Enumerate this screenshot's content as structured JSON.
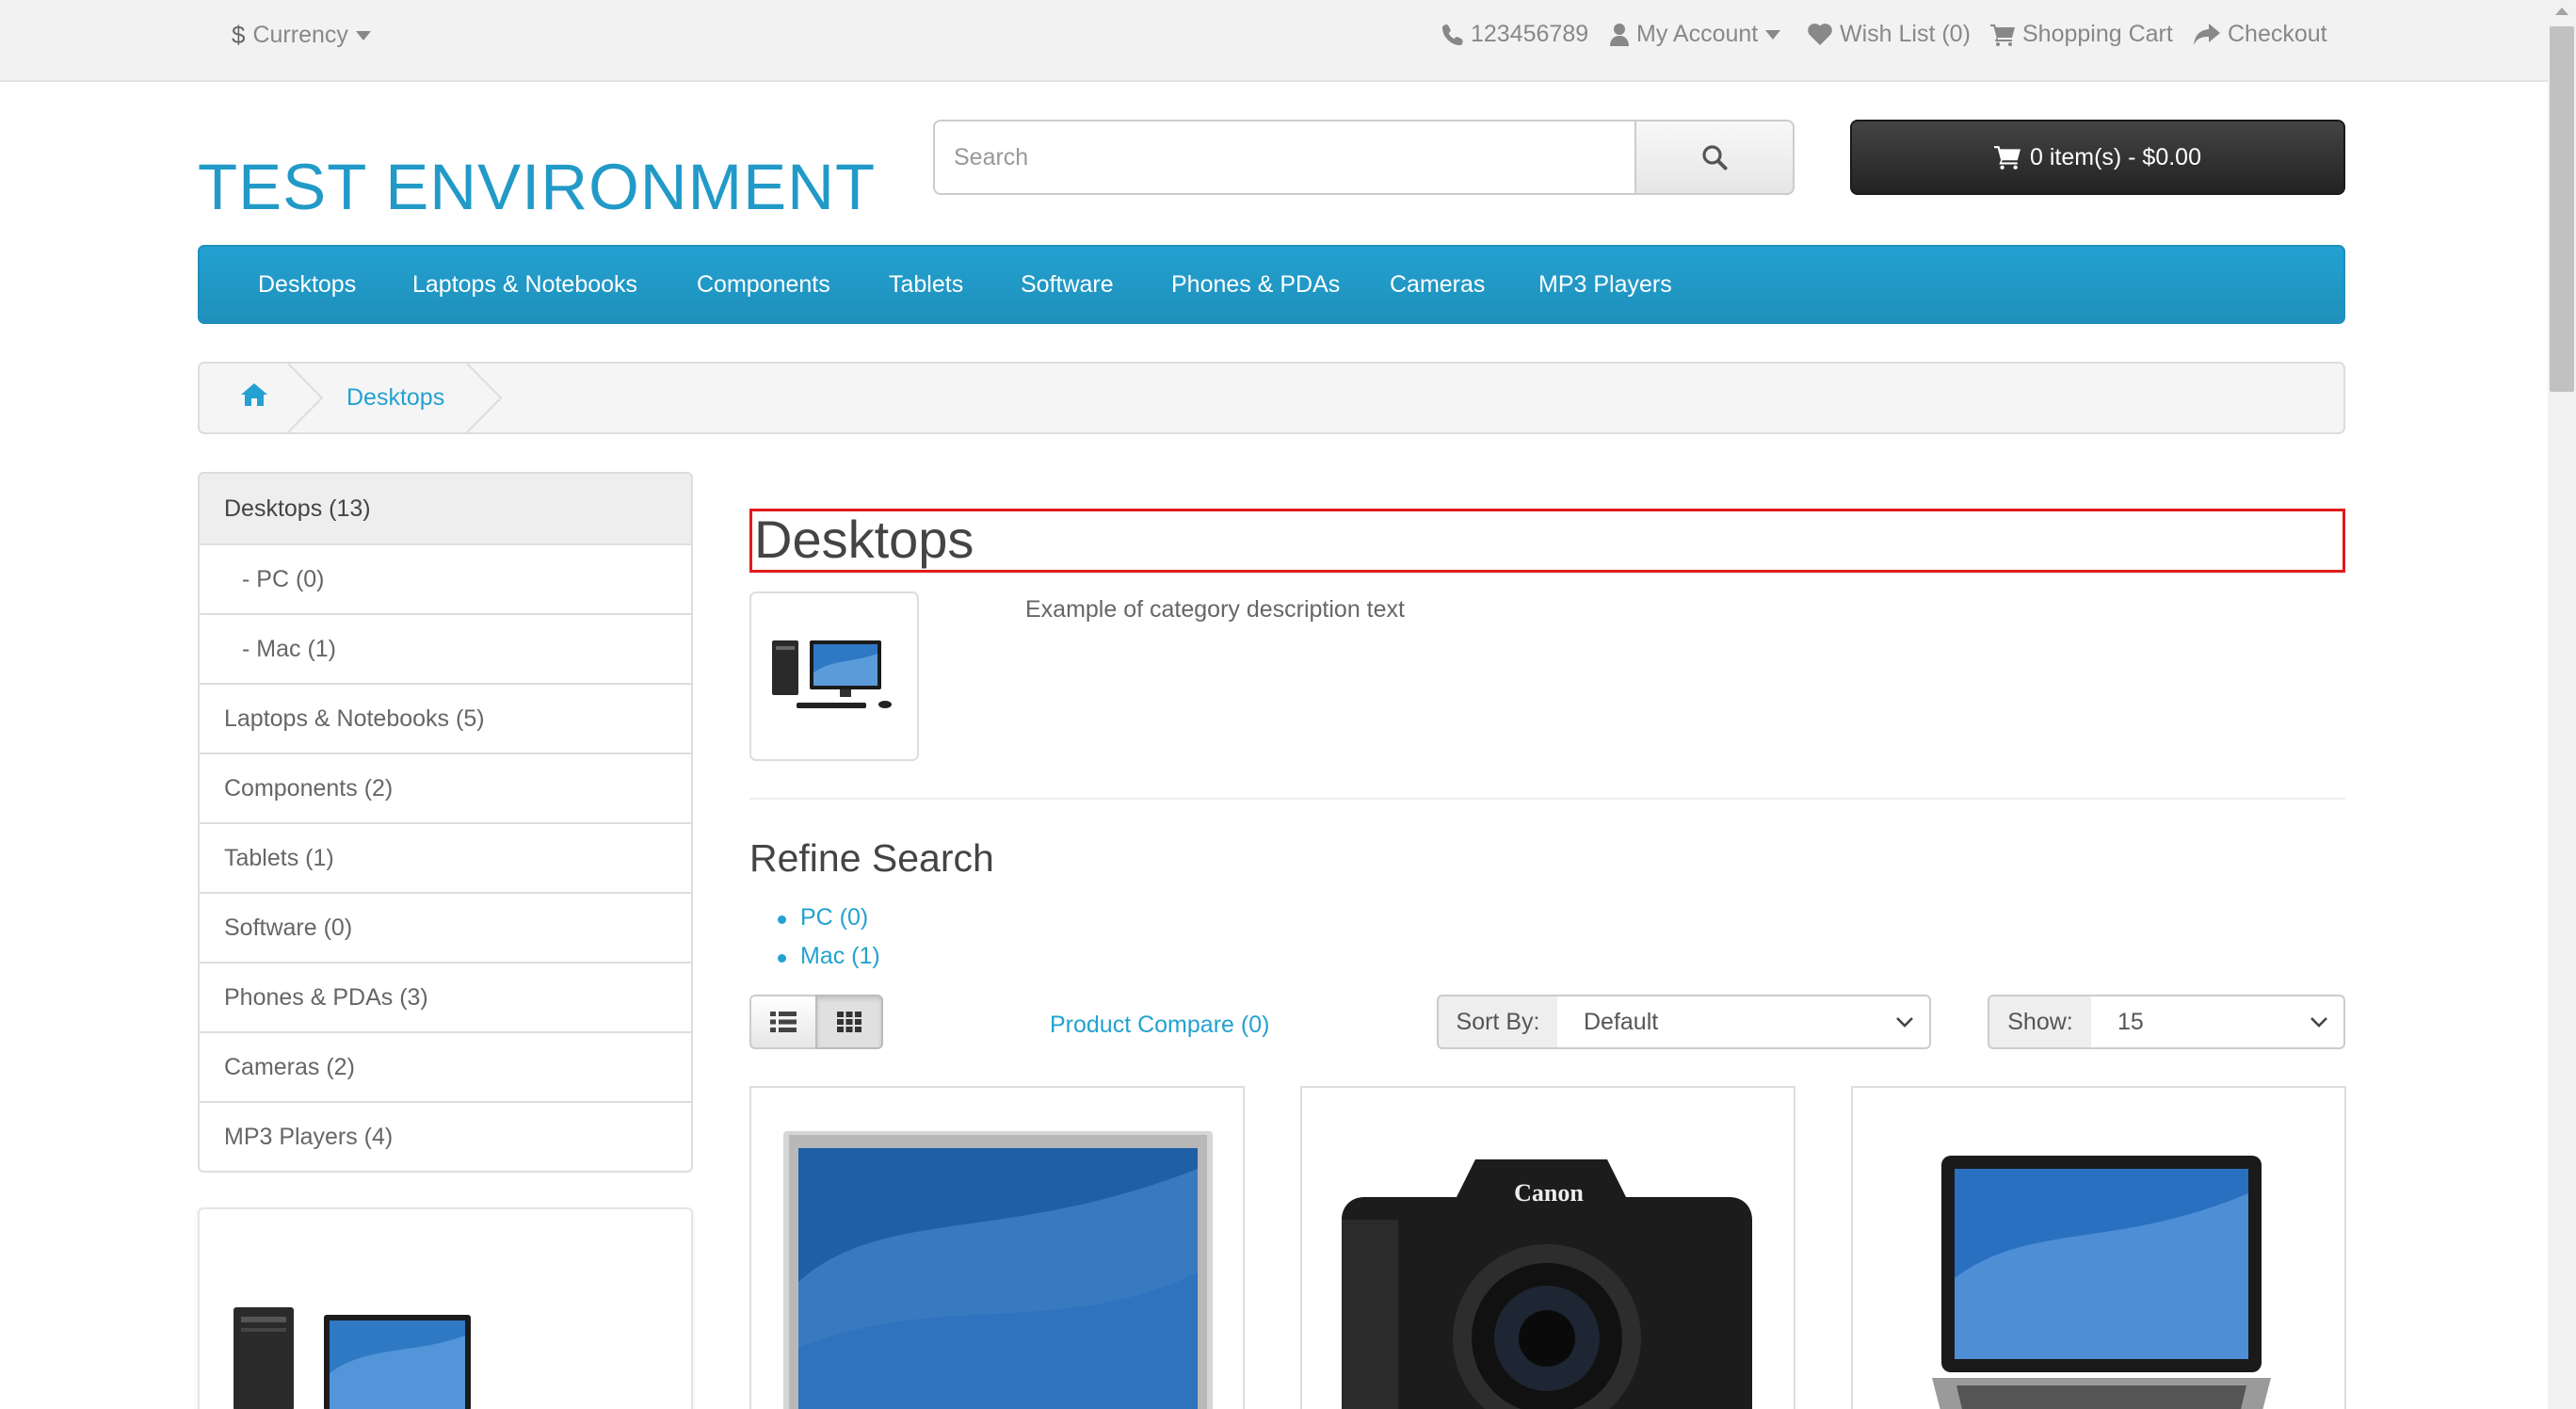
{
  "topbar": {
    "currency_label": "Currency",
    "currency_symbol": "$",
    "phone": "123456789",
    "my_account": "My Account",
    "wish_list": "Wish List (0)",
    "shopping_cart": "Shopping Cart",
    "checkout": "Checkout"
  },
  "header": {
    "logo": "TEST ENVIRONMENT",
    "search_placeholder": "Search",
    "cart_summary": "0 item(s) - $0.00"
  },
  "menu": {
    "items": [
      "Desktops",
      "Laptops & Notebooks",
      "Components",
      "Tablets",
      "Software",
      "Phones & PDAs",
      "Cameras",
      "MP3 Players"
    ]
  },
  "breadcrumb": {
    "home_icon": "home-icon",
    "current": "Desktops"
  },
  "sidebar": {
    "categories": [
      "Desktops (13)",
      "- PC (0)",
      "- Mac (1)",
      "Laptops & Notebooks (5)",
      "Components (2)",
      "Tablets (1)",
      "Software (0)",
      "Phones & PDAs (3)",
      "Cameras (2)",
      "MP3 Players (4)"
    ]
  },
  "content": {
    "title": "Desktops",
    "description": "Example of category description text",
    "refine_title": "Refine Search",
    "refine_links": [
      "PC (0)",
      "Mac (1)"
    ],
    "product_compare": "Product Compare (0)",
    "sort_label": "Sort By:",
    "sort_value": "Default",
    "show_label": "Show:",
    "show_value": "15"
  },
  "products": [
    {
      "image": "imac-monitor"
    },
    {
      "image": "canon-eos-5d-camera"
    },
    {
      "image": "laptop"
    }
  ],
  "colors": {
    "accent": "#229ac8",
    "menu_bg": "#23a1d1",
    "cart_bg": "#333333",
    "highlight_border": "#e01b1b"
  }
}
